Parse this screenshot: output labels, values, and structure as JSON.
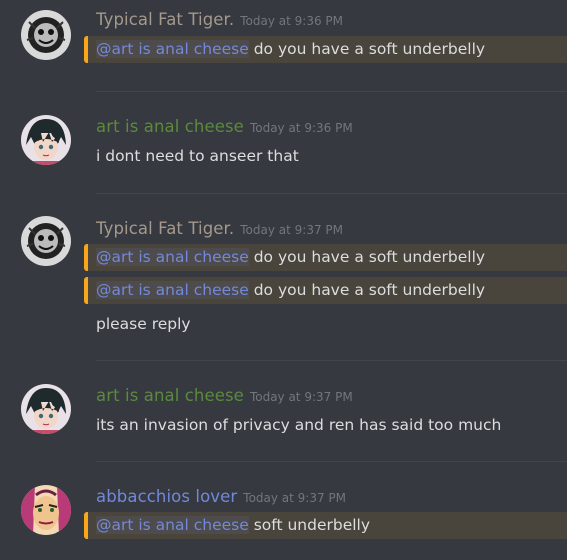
{
  "colors": {
    "background": "#36393f",
    "tiger_name": "#a4998c",
    "art_name": "#5b8a3d",
    "abbacchio_name": "#7289da",
    "mention": "#7289da",
    "highlight_bar": "#faa61a",
    "timestamp": "#72767d"
  },
  "messages": [
    {
      "username": "Typical Fat Tiger.",
      "timestamp": "Today at 9:36 PM",
      "avatar": "tiger-avatar-icon",
      "lines": [
        {
          "mention": "@art is anal cheese",
          "text": " do you have a soft underbelly",
          "highlighted": true
        }
      ]
    },
    {
      "username": "art is anal cheese",
      "timestamp": "Today at 9:36 PM",
      "avatar": "anime-boy-avatar-icon",
      "lines": [
        {
          "text": "i dont need to anseer that",
          "highlighted": false
        }
      ]
    },
    {
      "username": "Typical Fat Tiger.",
      "timestamp": "Today at 9:37 PM",
      "avatar": "tiger-avatar-icon",
      "lines": [
        {
          "mention": "@art is anal cheese",
          "text": " do you have a soft underbelly",
          "highlighted": true
        },
        {
          "mention": "@art is anal cheese",
          "text": " do you have a soft underbelly",
          "highlighted": true
        },
        {
          "text": "please reply",
          "highlighted": false
        }
      ]
    },
    {
      "username": "art is anal cheese",
      "timestamp": "Today at 9:37 PM",
      "avatar": "anime-boy-avatar-icon",
      "lines": [
        {
          "text": "its an invasion of privacy and ren has said too much",
          "highlighted": false
        }
      ]
    },
    {
      "username": "abbacchios lover",
      "timestamp": "Today at 9:37 PM",
      "avatar": "abbacchio-avatar-icon",
      "lines": [
        {
          "mention": "@art is anal cheese",
          "text": " soft underbelly",
          "highlighted": true
        }
      ]
    }
  ]
}
